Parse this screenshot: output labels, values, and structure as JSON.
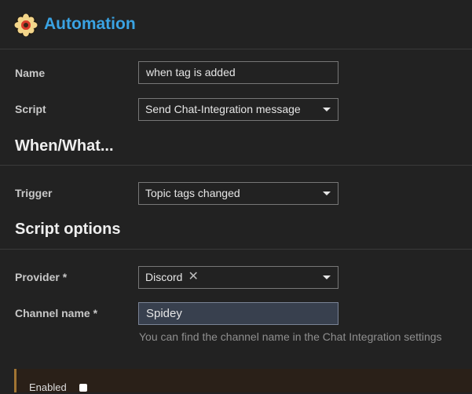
{
  "header": {
    "title": "Automation",
    "icon": "gear-flower-icon"
  },
  "form": {
    "name_label": "Name",
    "name_value": "when tag is added",
    "script_label": "Script",
    "script_value": "Send Chat-Integration message"
  },
  "when_section": {
    "title": "When/What...",
    "trigger_label": "Trigger",
    "trigger_value": "Topic tags changed"
  },
  "options_section": {
    "title": "Script options",
    "provider_label": "Provider *",
    "provider_value": "Discord",
    "provider_clear": "✕",
    "channel_label": "Channel name *",
    "channel_value": "Spidey",
    "channel_help": "You can find the channel name in the Chat Integration settings"
  },
  "footer": {
    "enabled_label": "Enabled",
    "enabled_checked": false
  },
  "colors": {
    "accent": "#3aa3e3",
    "footer_border": "#a17533",
    "background": "#222222"
  }
}
